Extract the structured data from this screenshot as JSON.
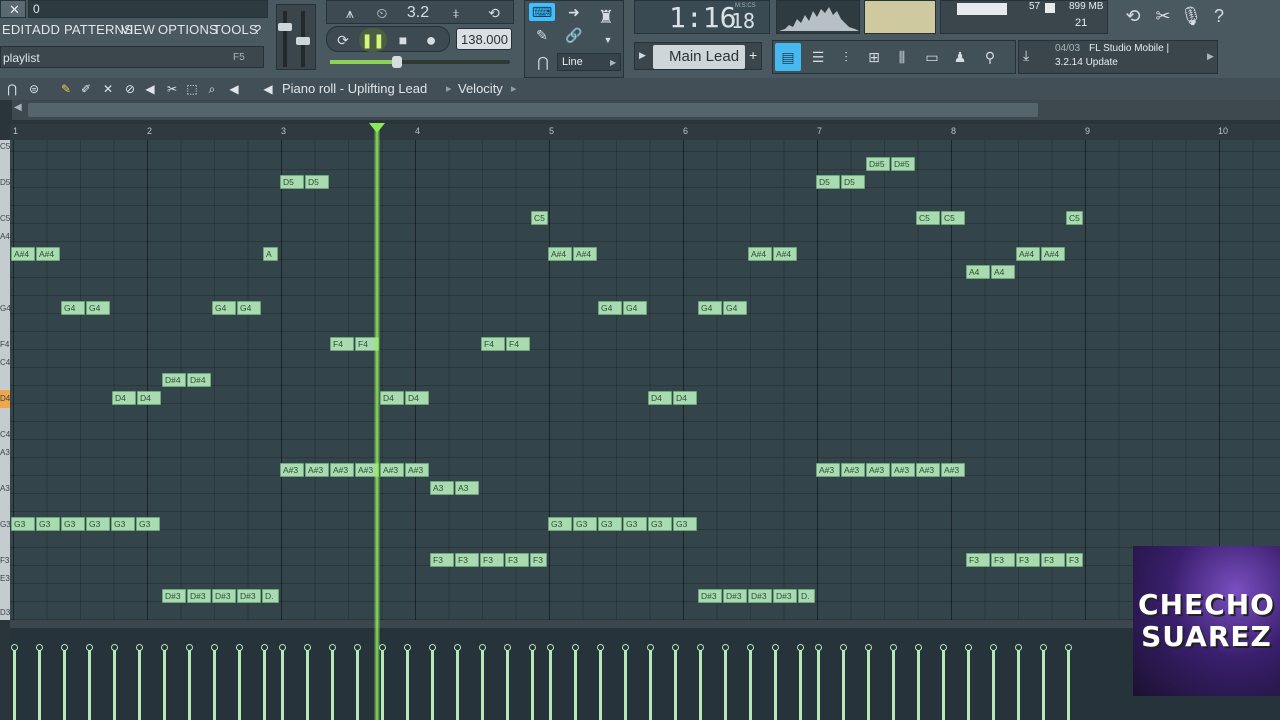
{
  "header": {
    "pattern_field": "0",
    "menu": [
      "EDIT",
      "ADD",
      "PATTERNS",
      "VIEW",
      "OPTIONS",
      "TOOLS",
      "?"
    ],
    "playlist_label": "playlist",
    "playlist_hotkey": "F5",
    "time_display": "1:16",
    "time_frac": "18",
    "time_format": "M:S:CS",
    "tempo": "138.000",
    "snap_mode": "Line",
    "channel_name": "Main Lead",
    "cpu_value": "57",
    "memory": "899 MB",
    "voices": "21",
    "news_date": "04/03",
    "news_text": "FL Studio Mobile |",
    "news_text2": "3.2.14 Update",
    "counter_label": "3.2"
  },
  "pianoroll": {
    "breadcrumb": [
      "Piano roll - Uplifting Lead",
      "Velocity"
    ],
    "bars": [
      "1",
      "2",
      "3",
      "4",
      "5",
      "6",
      "7",
      "8",
      "9",
      "10"
    ],
    "key_labels": [
      "C5",
      "D5",
      "C5",
      "A4",
      "G4",
      "F4",
      "C4",
      "D4",
      "C4",
      "A3",
      "A3",
      "G3",
      "F3",
      "E3",
      "D3"
    ]
  },
  "notes": [
    {
      "label": "D#5"
    },
    {
      "label": "D#5"
    },
    {
      "label": "D5"
    },
    {
      "label": "D5"
    },
    {
      "label": "D5"
    },
    {
      "label": "D5"
    },
    {
      "label": "C5"
    },
    {
      "label": "C5"
    },
    {
      "label": "C5"
    },
    {
      "label": "C5"
    },
    {
      "label": "A#4"
    },
    {
      "label": "A#4"
    },
    {
      "label": "A"
    },
    {
      "label": "A#4"
    },
    {
      "label": "A#4"
    },
    {
      "label": "A#4"
    },
    {
      "label": "A#4"
    },
    {
      "label": "A#4"
    },
    {
      "label": "A#4"
    },
    {
      "label": "A4"
    },
    {
      "label": "A4"
    },
    {
      "label": "G4"
    },
    {
      "label": "G4"
    },
    {
      "label": "G4"
    },
    {
      "label": "G4"
    },
    {
      "label": "G4"
    },
    {
      "label": "G4"
    },
    {
      "label": "G4"
    },
    {
      "label": "G4"
    },
    {
      "label": "F4"
    },
    {
      "label": "F4"
    },
    {
      "label": "F4"
    },
    {
      "label": "F4"
    },
    {
      "label": "D#4"
    },
    {
      "label": "D#4"
    },
    {
      "label": "D4"
    },
    {
      "label": "D4"
    },
    {
      "label": "D4"
    },
    {
      "label": "D4"
    },
    {
      "label": "D4"
    },
    {
      "label": "D4"
    },
    {
      "label": "A#3"
    },
    {
      "label": "A#3"
    },
    {
      "label": "A#3"
    },
    {
      "label": "A#3"
    },
    {
      "label": "A#3"
    },
    {
      "label": "A#3"
    },
    {
      "label": "A#3"
    },
    {
      "label": "A#3"
    },
    {
      "label": "A#3"
    },
    {
      "label": "A#3"
    },
    {
      "label": "A#3"
    },
    {
      "label": "A#3"
    },
    {
      "label": "A3"
    },
    {
      "label": "A3"
    },
    {
      "label": "G3"
    },
    {
      "label": "G3"
    },
    {
      "label": "G3"
    },
    {
      "label": "G3"
    },
    {
      "label": "G3"
    },
    {
      "label": "G3"
    },
    {
      "label": "G3"
    },
    {
      "label": "G3"
    },
    {
      "label": "G3"
    },
    {
      "label": "G3"
    },
    {
      "label": "G3"
    },
    {
      "label": "G3"
    },
    {
      "label": "F3"
    },
    {
      "label": "F3"
    },
    {
      "label": "F3"
    },
    {
      "label": "F3"
    },
    {
      "label": "F3"
    },
    {
      "label": "F3"
    },
    {
      "label": "F3"
    },
    {
      "label": "F3"
    },
    {
      "label": "F3"
    },
    {
      "label": "F3"
    },
    {
      "label": "D#3"
    },
    {
      "label": "D#3"
    },
    {
      "label": "D#3"
    },
    {
      "label": "D#3"
    },
    {
      "label": "D."
    },
    {
      "label": "D#3"
    },
    {
      "label": "D#3"
    },
    {
      "label": "D#3"
    },
    {
      "label": "D#3"
    },
    {
      "label": "D."
    }
  ],
  "watermark": {
    "line1": "CHECHO",
    "line2": "SUAREZ"
  },
  "colors": {
    "note_fill": "#a8dcb0",
    "playhead": "#8bea5a",
    "grid_bg": "#34444b"
  }
}
